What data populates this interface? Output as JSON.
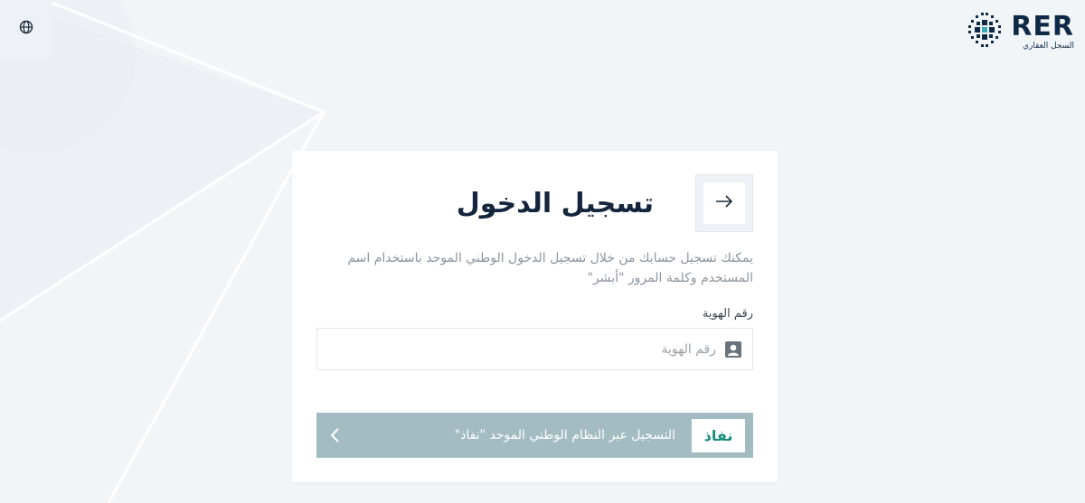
{
  "header": {
    "logo_title": "RER",
    "logo_subtitle": "السجل العقاري",
    "language_icon": "globe-icon"
  },
  "login": {
    "title": "تسجيل الدخول",
    "title_icon": "arrow-right-icon",
    "description": "يمكنك تسجيل حسابك من خلال تسجيل الدخول الوطني الموحد باستخدام اسم المستخدم وكلمة المرور \"أبشر\"",
    "id_label": "رقم الهوية",
    "id_placeholder": "رقم الهوية",
    "id_value": "",
    "id_icon": "user-icon",
    "nafath_logo_text": "نفاذ",
    "nafath_button_label": "التسجيل عبر النظام الوطني الموحد \"نفاذ\"",
    "nafath_chevron_icon": "chevron-left-icon"
  },
  "colors": {
    "background": "#f2f5f8",
    "card": "#ffffff",
    "primary_dark": "#14263d",
    "nafath_button": "#a3bcc2",
    "nafath_green": "#158a7a",
    "muted_text": "#8a949e"
  }
}
